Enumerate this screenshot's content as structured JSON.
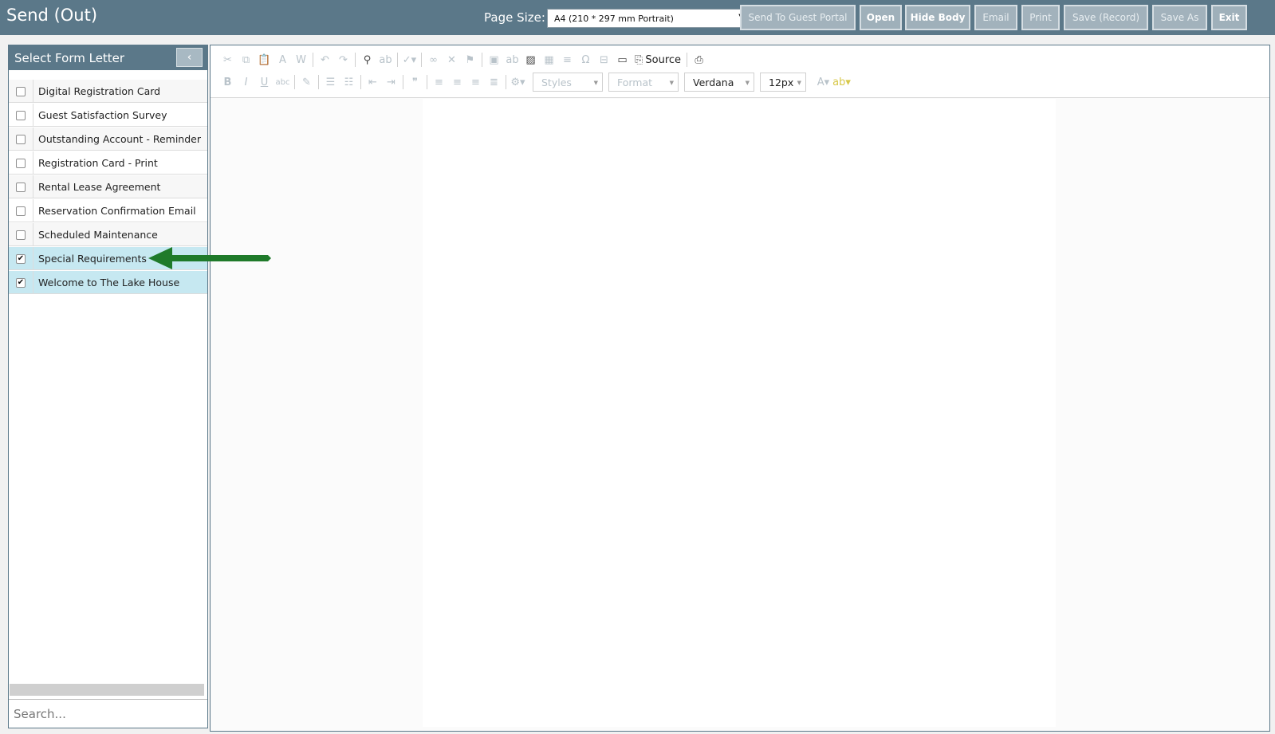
{
  "header": {
    "title": "Send (Out)",
    "page_size_label": "Page Size:",
    "page_size_value": "A4 (210 * 297 mm Portrait)",
    "buttons": [
      {
        "label": "Send To Guest Portal",
        "active": false
      },
      {
        "label": "Open",
        "active": true
      },
      {
        "label": "Hide Body",
        "active": true
      },
      {
        "label": "Email",
        "active": false
      },
      {
        "label": "Print",
        "active": false
      },
      {
        "label": "Save (Record)",
        "active": false
      },
      {
        "label": "Save As",
        "active": false
      },
      {
        "label": "Exit",
        "active": true
      }
    ]
  },
  "sidebar": {
    "title": "Select Form Letter",
    "collapse_icon": "chevron-left-icon",
    "items": [
      {
        "label": "Digital Registration Card",
        "checked": false
      },
      {
        "label": "Guest Satisfaction Survey",
        "checked": false
      },
      {
        "label": "Outstanding Account - Reminder",
        "checked": false
      },
      {
        "label": "Registration Card - Print",
        "checked": false
      },
      {
        "label": "Rental Lease Agreement",
        "checked": false
      },
      {
        "label": "Reservation Confirmation Email",
        "checked": false
      },
      {
        "label": "Scheduled Maintenance",
        "checked": false
      },
      {
        "label": "Special Requirements",
        "checked": true
      },
      {
        "label": "Welcome to The Lake House",
        "checked": true
      }
    ],
    "search_placeholder": "Search..."
  },
  "editor": {
    "source_label": "Source",
    "styles_label": "Styles",
    "format_label": "Format",
    "font_value": "Verdana",
    "size_value": "12px"
  },
  "colors": {
    "header_bg": "#5b7889",
    "selected_row": "#c6e8f1",
    "arrow": "#1f7a2a"
  }
}
